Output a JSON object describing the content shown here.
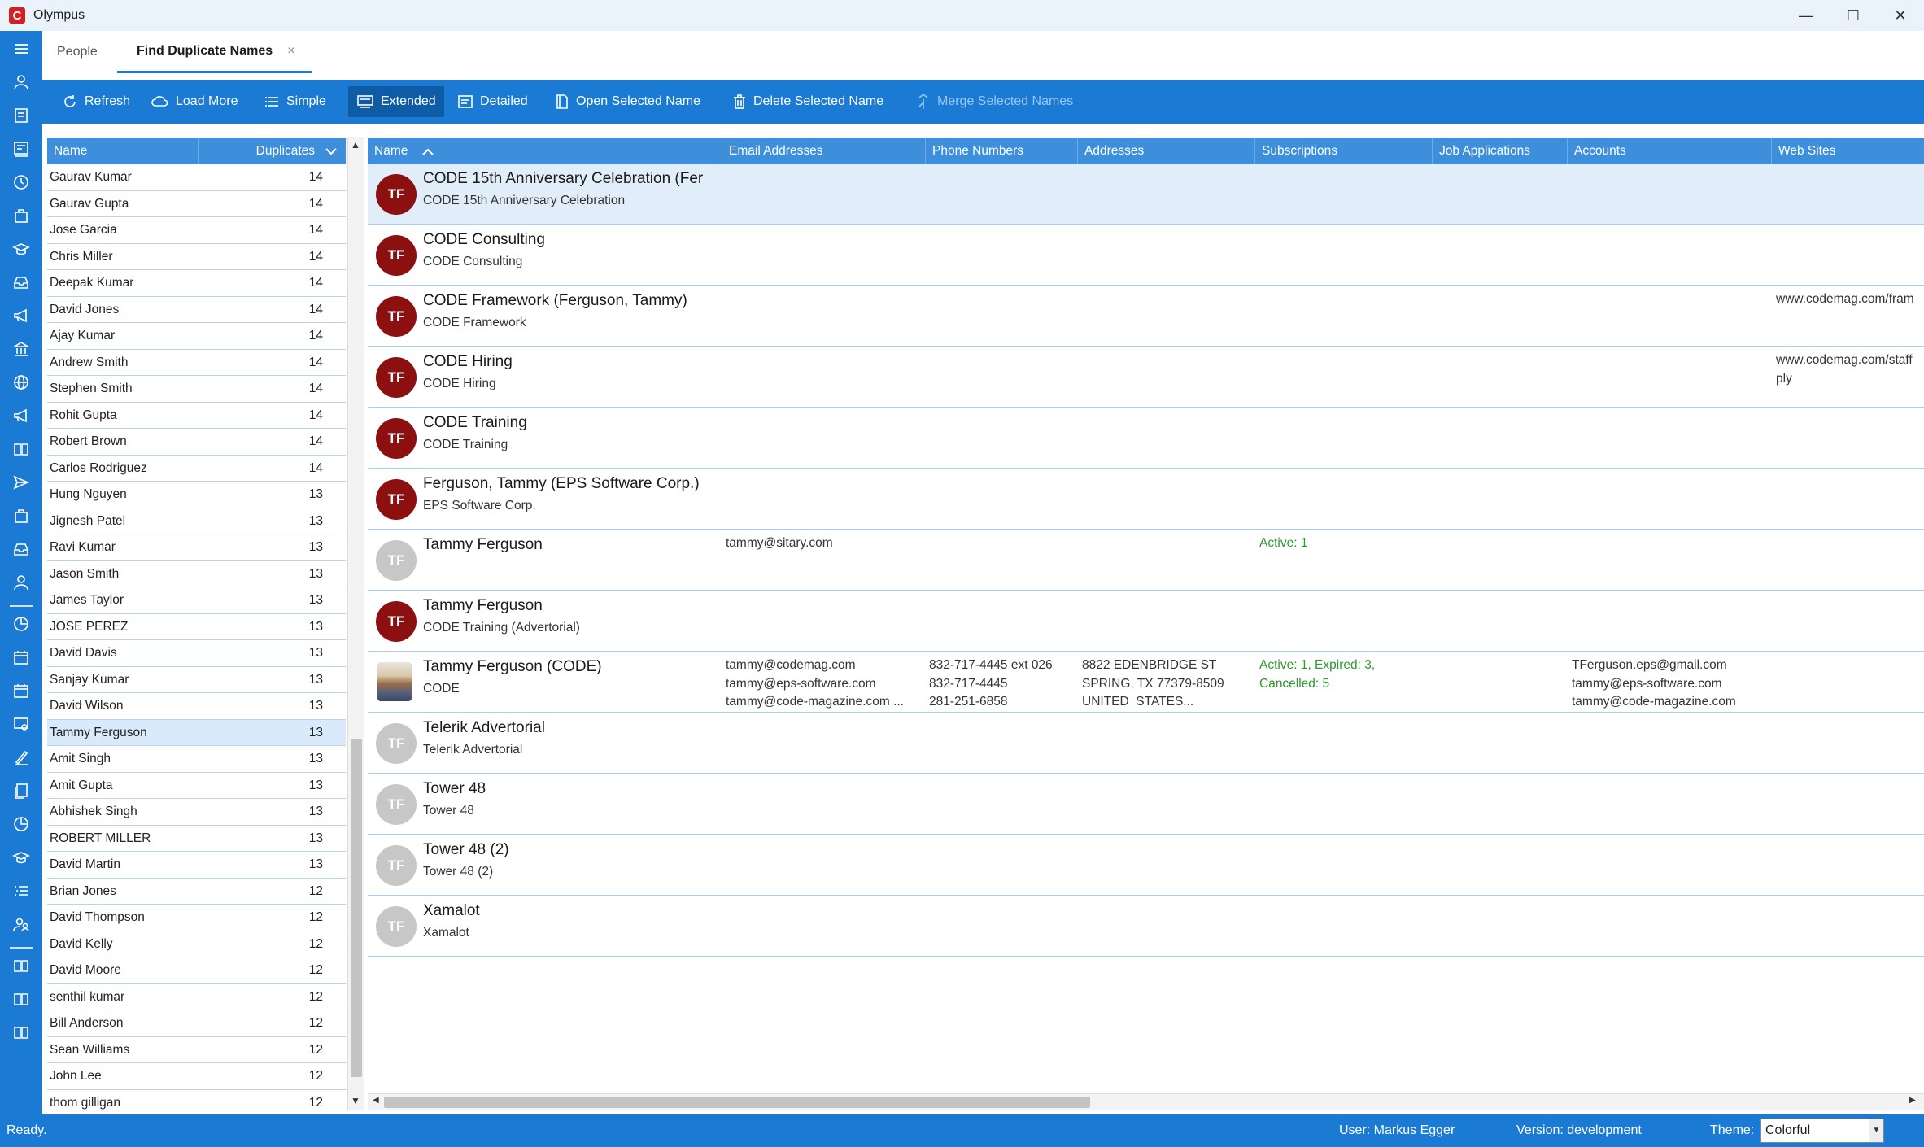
{
  "window": {
    "title": "Olympus",
    "minimize": "—",
    "maximize": "☐",
    "close": "✕"
  },
  "tabs": [
    {
      "label": "People"
    },
    {
      "label": "Find Duplicate Names",
      "close": "×"
    }
  ],
  "toolbar": {
    "refresh": "Refresh",
    "load_more": "Load More",
    "simple": "Simple",
    "extended": "Extended",
    "detailed": "Detailed",
    "open_selected": "Open Selected Name",
    "delete_selected": "Delete Selected Name",
    "merge_selected": "Merge Selected Names"
  },
  "names_list": {
    "columns": {
      "name": "Name",
      "duplicates": "Duplicates"
    },
    "rows": [
      {
        "name": "Gaurav Kumar",
        "count": "14"
      },
      {
        "name": "Gaurav Gupta",
        "count": "14"
      },
      {
        "name": "Jose Garcia",
        "count": "14"
      },
      {
        "name": "Chris Miller",
        "count": "14"
      },
      {
        "name": "Deepak Kumar",
        "count": "14"
      },
      {
        "name": "David Jones",
        "count": "14"
      },
      {
        "name": "Ajay Kumar",
        "count": "14"
      },
      {
        "name": "Andrew Smith",
        "count": "14"
      },
      {
        "name": "Stephen Smith",
        "count": "14"
      },
      {
        "name": "Rohit Gupta",
        "count": "14"
      },
      {
        "name": "Robert Brown",
        "count": "14"
      },
      {
        "name": "Carlos Rodriguez",
        "count": "14"
      },
      {
        "name": "Hung Nguyen",
        "count": "13"
      },
      {
        "name": "Jignesh Patel",
        "count": "13"
      },
      {
        "name": "Ravi Kumar",
        "count": "13"
      },
      {
        "name": "Jason Smith",
        "count": "13"
      },
      {
        "name": "James Taylor",
        "count": "13"
      },
      {
        "name": "JOSE PEREZ",
        "count": "13"
      },
      {
        "name": "David Davis",
        "count": "13"
      },
      {
        "name": "Sanjay Kumar",
        "count": "13"
      },
      {
        "name": "David Wilson",
        "count": "13"
      },
      {
        "name": "Tammy Ferguson",
        "count": "13",
        "selected": true
      },
      {
        "name": "Amit Singh",
        "count": "13"
      },
      {
        "name": "Amit Gupta",
        "count": "13"
      },
      {
        "name": "Abhishek Singh",
        "count": "13"
      },
      {
        "name": "ROBERT MILLER",
        "count": "13"
      },
      {
        "name": "David Martin",
        "count": "13"
      },
      {
        "name": "Brian Jones",
        "count": "12"
      },
      {
        "name": "David Thompson",
        "count": "12"
      },
      {
        "name": "David Kelly",
        "count": "12"
      },
      {
        "name": "David Moore",
        "count": "12"
      },
      {
        "name": "senthil kumar",
        "count": "12"
      },
      {
        "name": "Bill Anderson",
        "count": "12"
      },
      {
        "name": "Sean Williams",
        "count": "12"
      },
      {
        "name": "John Lee",
        "count": "12"
      },
      {
        "name": "thom gilligan",
        "count": "12"
      }
    ]
  },
  "grid": {
    "columns": {
      "name": "Name",
      "email": "Email Addresses",
      "phone": "Phone Numbers",
      "addresses": "Addresses",
      "subscriptions": "Subscriptions",
      "jobs": "Job Applications",
      "accounts": "Accounts",
      "websites": "Web Sites"
    },
    "rows": [
      {
        "initials": "TF",
        "avatar": "dark",
        "name": "CODE 15th Anniversary Celebration (Fer",
        "sub": "CODE 15th Anniversary Celebration",
        "selected": true
      },
      {
        "initials": "TF",
        "avatar": "dark",
        "name": "CODE Consulting",
        "sub": "CODE Consulting"
      },
      {
        "initials": "TF",
        "avatar": "dark",
        "name": "CODE Framework (Ferguson, Tammy)",
        "sub": "CODE Framework",
        "websites": "www.codemag.com/fram"
      },
      {
        "initials": "TF",
        "avatar": "dark",
        "name": "CODE Hiring",
        "sub": "CODE Hiring",
        "websites": "www.codemag.com/staff\nply"
      },
      {
        "initials": "TF",
        "avatar": "dark",
        "name": "CODE Training",
        "sub": "CODE Training"
      },
      {
        "initials": "TF",
        "avatar": "dark",
        "name": "Ferguson, Tammy (EPS Software Corp.)",
        "sub": "EPS Software Corp."
      },
      {
        "initials": "TF",
        "avatar": "grey",
        "name": "Tammy Ferguson",
        "sub": "",
        "email": "tammy@sitary.com",
        "subscriptions": "Active: 1"
      },
      {
        "initials": "TF",
        "avatar": "dark",
        "name": "Tammy Ferguson",
        "sub": "CODE Training (Advertorial)"
      },
      {
        "initials": "",
        "avatar": "photo",
        "name": "Tammy Ferguson (CODE)",
        "sub": "CODE",
        "email": "tammy@codemag.com\ntammy@eps-software.com\ntammy@code-magazine.com ...",
        "phone": "832-717-4445 ext 026\n832-717-4445\n281-251-6858",
        "addresses": "8822 EDENBRIDGE ST\nSPRING, TX 77379-8509\nUNITED  STATES...",
        "subscriptions": "Active: 1, Expired: 3,\nCancelled: 5",
        "accounts": "TFerguson.eps@gmail.com\ntammy@eps-software.com\ntammy@code-magazine.com"
      },
      {
        "initials": "TF",
        "avatar": "grey",
        "name": "Telerik Advertorial",
        "sub": "Telerik Advertorial"
      },
      {
        "initials": "TF",
        "avatar": "grey",
        "name": "Tower 48",
        "sub": "Tower 48"
      },
      {
        "initials": "TF",
        "avatar": "grey",
        "name": "Tower 48 (2)",
        "sub": "Tower 48 (2)"
      },
      {
        "initials": "TF",
        "avatar": "grey",
        "name": "Xamalot",
        "sub": "Xamalot"
      }
    ]
  },
  "status": {
    "ready": "Ready.",
    "user": "User: Markus Egger",
    "version": "Version: development",
    "theme_label": "Theme:",
    "theme_value": "Colorful"
  },
  "colors": {
    "accent": "#1a7ad4",
    "header": "#3d8fdc",
    "avatar_dark": "#8c1010",
    "avatar_grey": "#c7c7c7",
    "subscription_green": "#2c9a2c"
  },
  "icons": [
    "menu-icon",
    "person-icon",
    "notebook-icon",
    "news-icon",
    "clock-icon",
    "briefcase-icon",
    "graduation-icon",
    "inbox-icon",
    "megaphone-icon",
    "bank-icon",
    "globe-icon",
    "book-icon",
    "send-icon",
    "pie-icon",
    "calendar-icon",
    "image-card-icon",
    "pen-icon",
    "documents-icon",
    "list-icon",
    "people-icon"
  ]
}
